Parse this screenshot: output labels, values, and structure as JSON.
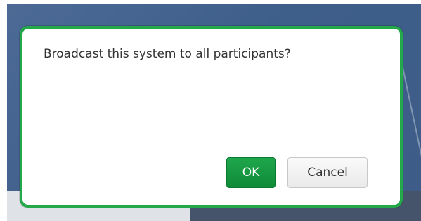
{
  "dialog": {
    "message": "Broadcast this system to all participants?",
    "ok_label": "OK",
    "cancel_label": "Cancel"
  },
  "colors": {
    "accent_border": "#23a84a",
    "ok_button": "#129a42",
    "backdrop": "#456590"
  }
}
